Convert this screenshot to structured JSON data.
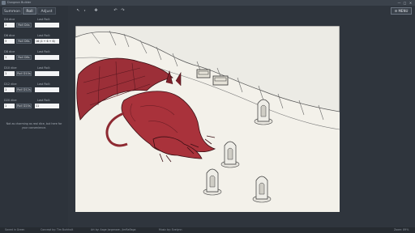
{
  "window": {
    "title": "Dungeon Builder",
    "minimize": "—",
    "maximize": "□",
    "close": "✕"
  },
  "tabs": [
    "Summon",
    "Roll",
    "Adjust"
  ],
  "dice": [
    {
      "label": "D4 dice",
      "count": "1",
      "button": "Roll D4s",
      "last_label": "Last Roll:",
      "last": ""
    },
    {
      "label": "D6 dice",
      "count": "3",
      "button": "Roll D6s",
      "last_label": "Last Roll:",
      "last": "16 (4 + 6 + 6)"
    },
    {
      "label": "D8 dice",
      "count": "1",
      "button": "Roll D8s",
      "last_label": "Last Roll:",
      "last": ""
    },
    {
      "label": "D10 dice",
      "count": "1",
      "button": "Roll D10s",
      "last_label": "Last Roll:",
      "last": ""
    },
    {
      "label": "D12 dice",
      "count": "1",
      "button": "Roll D12s",
      "last_label": "Last Roll:",
      "last": ""
    },
    {
      "label": "D20 dice",
      "count": "1",
      "button": "Roll D20s",
      "last_label": "Last Roll:",
      "last": "11"
    }
  ],
  "note": "Not as charming as real dice, but here for your convenience.",
  "toolbar": {
    "select_icon": "cursor-icon",
    "pan_icon": "move-icon",
    "undo_icon": "undo-icon",
    "redo_icon": "redo-icon",
    "menu_label": "MENU",
    "menu_glyph": "☰"
  },
  "status": {
    "saved": "Saved in Green",
    "concept": "Concept by: Tim Burkholt",
    "art": "Art by: Aage Jorgensen, JimRaflaga",
    "music": "Music by: Evelynn",
    "zoom": "Zoom: 89%"
  },
  "colors": {
    "panel": "#2d333b",
    "canvas": "#f3f1ea",
    "dragon": "#a9323b"
  }
}
